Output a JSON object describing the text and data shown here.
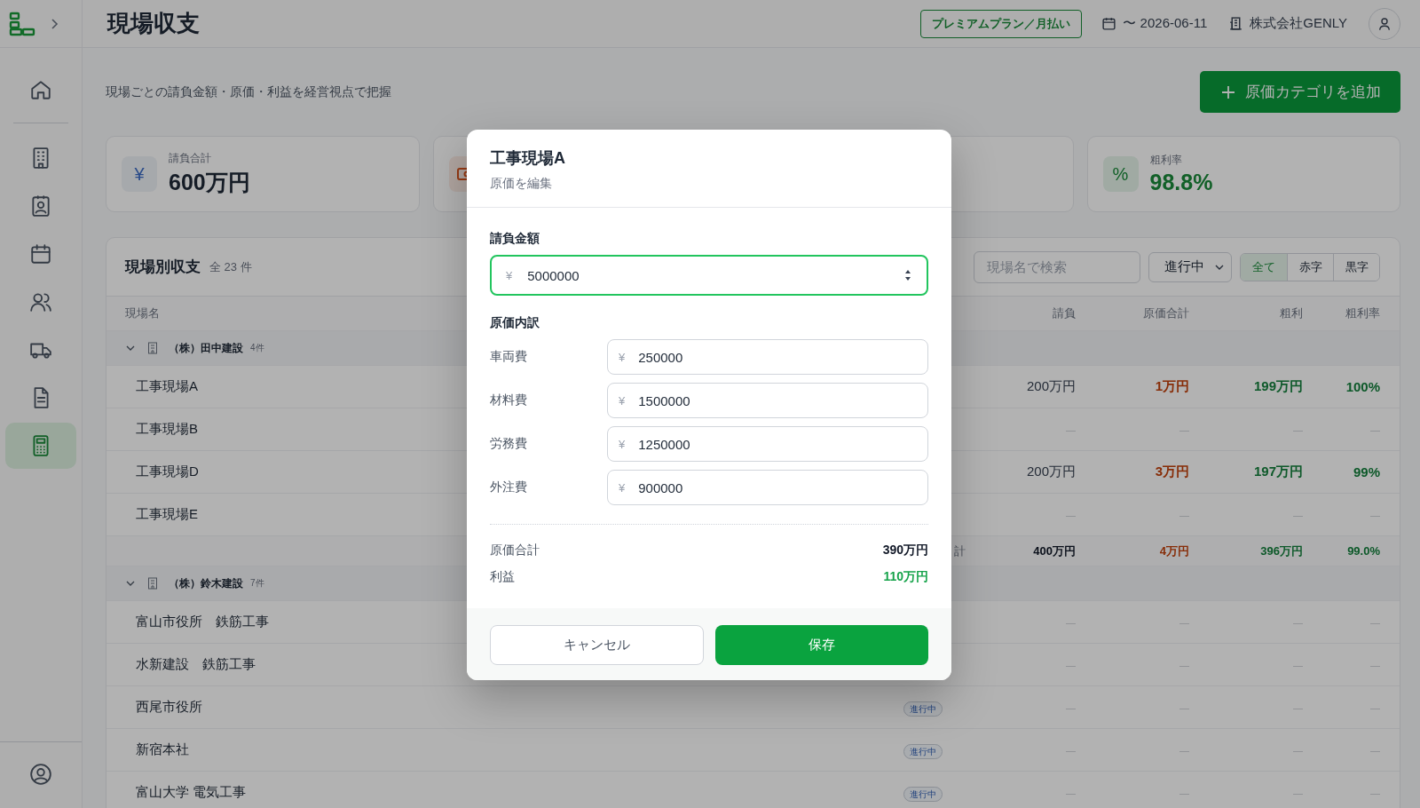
{
  "header": {
    "title": "現場収支",
    "plan": "プレミアムプラン／月払い",
    "date": "〜 2026-06-11",
    "company": "株式会社GENLY"
  },
  "sidebar": {
    "items": [
      {
        "selected": false
      },
      {
        "selected": false
      },
      {
        "selected": false
      },
      {
        "selected": false
      },
      {
        "selected": false
      },
      {
        "selected": false
      },
      {
        "selected": false
      },
      {
        "selected": true
      },
      {
        "selected": false
      }
    ]
  },
  "page": {
    "subtitle": "現場ごとの請負金額・原価・利益を経営視点で把握",
    "add_button": "原価カテゴリを追加"
  },
  "cards": [
    {
      "kind": "revenue",
      "glyph": "¥",
      "label": "請負合計",
      "value": "600万円"
    },
    {
      "kind": "cost"
    },
    {
      "kind": "blank"
    },
    {
      "kind": "rate",
      "glyph": "%",
      "label": "粗利率",
      "value": "98.8%"
    }
  ],
  "table": {
    "title": "現場別収支",
    "count": "全 23 件",
    "search": {
      "placeholder": "現場名で検索"
    },
    "status_filter": "進行中",
    "filters": [
      {
        "label": "全て",
        "selected": true
      },
      {
        "label": "赤字",
        "selected": false
      },
      {
        "label": "黒字",
        "selected": false
      }
    ],
    "columns": [
      "現場名",
      "",
      "請負",
      "原価合計",
      "粗利",
      "粗利率"
    ],
    "groups": [
      {
        "name": "（株）田中建設",
        "count": "4件",
        "expanded": true,
        "rows": [
          {
            "kind": "data",
            "name": "工事現場A",
            "values": [
              "200万円",
              "1万円",
              "199万円",
              "100%"
            ]
          },
          {
            "kind": "empty",
            "name": "工事現場B",
            "values": [
              "—",
              "—",
              "—",
              "—"
            ]
          },
          {
            "kind": "data",
            "name": "工事現場D",
            "values": [
              "200万円",
              "3万円",
              "197万円",
              "99%"
            ]
          },
          {
            "kind": "empty",
            "name": "工事現場E",
            "values": [
              "—",
              "—",
              "—",
              "—"
            ]
          }
        ],
        "subtotal": {
          "label": "計",
          "values": [
            "400万円",
            "4万円",
            "396万円",
            "99.0%"
          ]
        }
      },
      {
        "name": "（株）鈴木建設",
        "count": "7件",
        "expanded": true,
        "rows": [
          {
            "kind": "empty",
            "name": "富山市役所　鉄筋工事",
            "values": [
              "—",
              "—",
              "—",
              "—"
            ]
          },
          {
            "kind": "empty",
            "name": "水新建設　鉄筋工事",
            "values": [
              "—",
              "—",
              "—",
              "—"
            ]
          },
          {
            "kind": "empty",
            "name": "西尾市役所",
            "status": "進行中",
            "values": [
              "—",
              "—",
              "—",
              "—"
            ]
          },
          {
            "kind": "empty",
            "name": "新宿本社",
            "status": "進行中",
            "values": [
              "—",
              "—",
              "—",
              "—"
            ]
          },
          {
            "kind": "empty",
            "name": "富山大学 電気工事",
            "status": "進行中",
            "values": [
              "—",
              "—",
              "—",
              "—"
            ]
          }
        ]
      }
    ]
  },
  "modal": {
    "title": "工事現場A",
    "subtitle": "原価を編集",
    "amount_label": "請負金額",
    "currency": "¥",
    "amount": "5000000",
    "breakdown_label": "原価内訳",
    "items": [
      {
        "label": "車両費",
        "value": "250000"
      },
      {
        "label": "材料費",
        "value": "1500000"
      },
      {
        "label": "労務費",
        "value": "1250000"
      },
      {
        "label": "外注費",
        "value": "900000"
      }
    ],
    "total_label": "原価合計",
    "total": "390万円",
    "profit_label": "利益",
    "profit": "110万円",
    "cancel": "キャンセル",
    "save": "保存"
  }
}
